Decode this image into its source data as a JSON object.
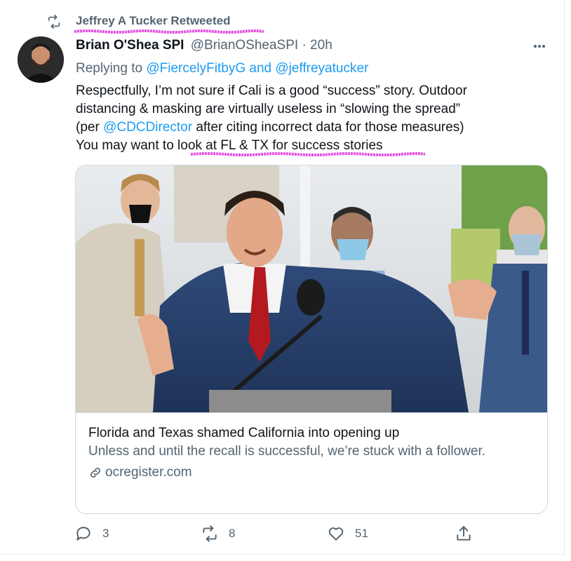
{
  "retweet": {
    "text": "Jeffrey A Tucker Retweeted",
    "icon": "retweet-icon"
  },
  "tweet": {
    "author_name": "Brian O'Shea SPI",
    "author_handle": "@BrianOSheaSPI · 20h",
    "replying_prefix": "Replying to ",
    "reply_to_1": "@FiercelyFitbyG",
    "reply_and": " and ",
    "reply_to_2": "@jeffreyatucker",
    "line1": "Respectfully, I’m not sure if Cali is a good “success” story. Outdoor",
    "line2": "distancing & masking are virtually useless  in “slowing the spread”",
    "line3_pre": "(per ",
    "line3_mention": "@CDCDirector",
    "line3_post": " after citing incorrect data for those measures)",
    "line4": "You may want to look at FL & TX for success stories"
  },
  "link_card": {
    "title": "Florida and Texas shamed California into opening up",
    "description": "Unless and until the recall is successful, we’re stuck with a follower.",
    "domain": "ocregister.com"
  },
  "actions": {
    "replies": "3",
    "retweets": "8",
    "likes": "51"
  },
  "colors": {
    "highlight": "#e24fe0",
    "link": "#1d9bf0",
    "secondary_text": "#536471",
    "border": "#cfd9de"
  }
}
